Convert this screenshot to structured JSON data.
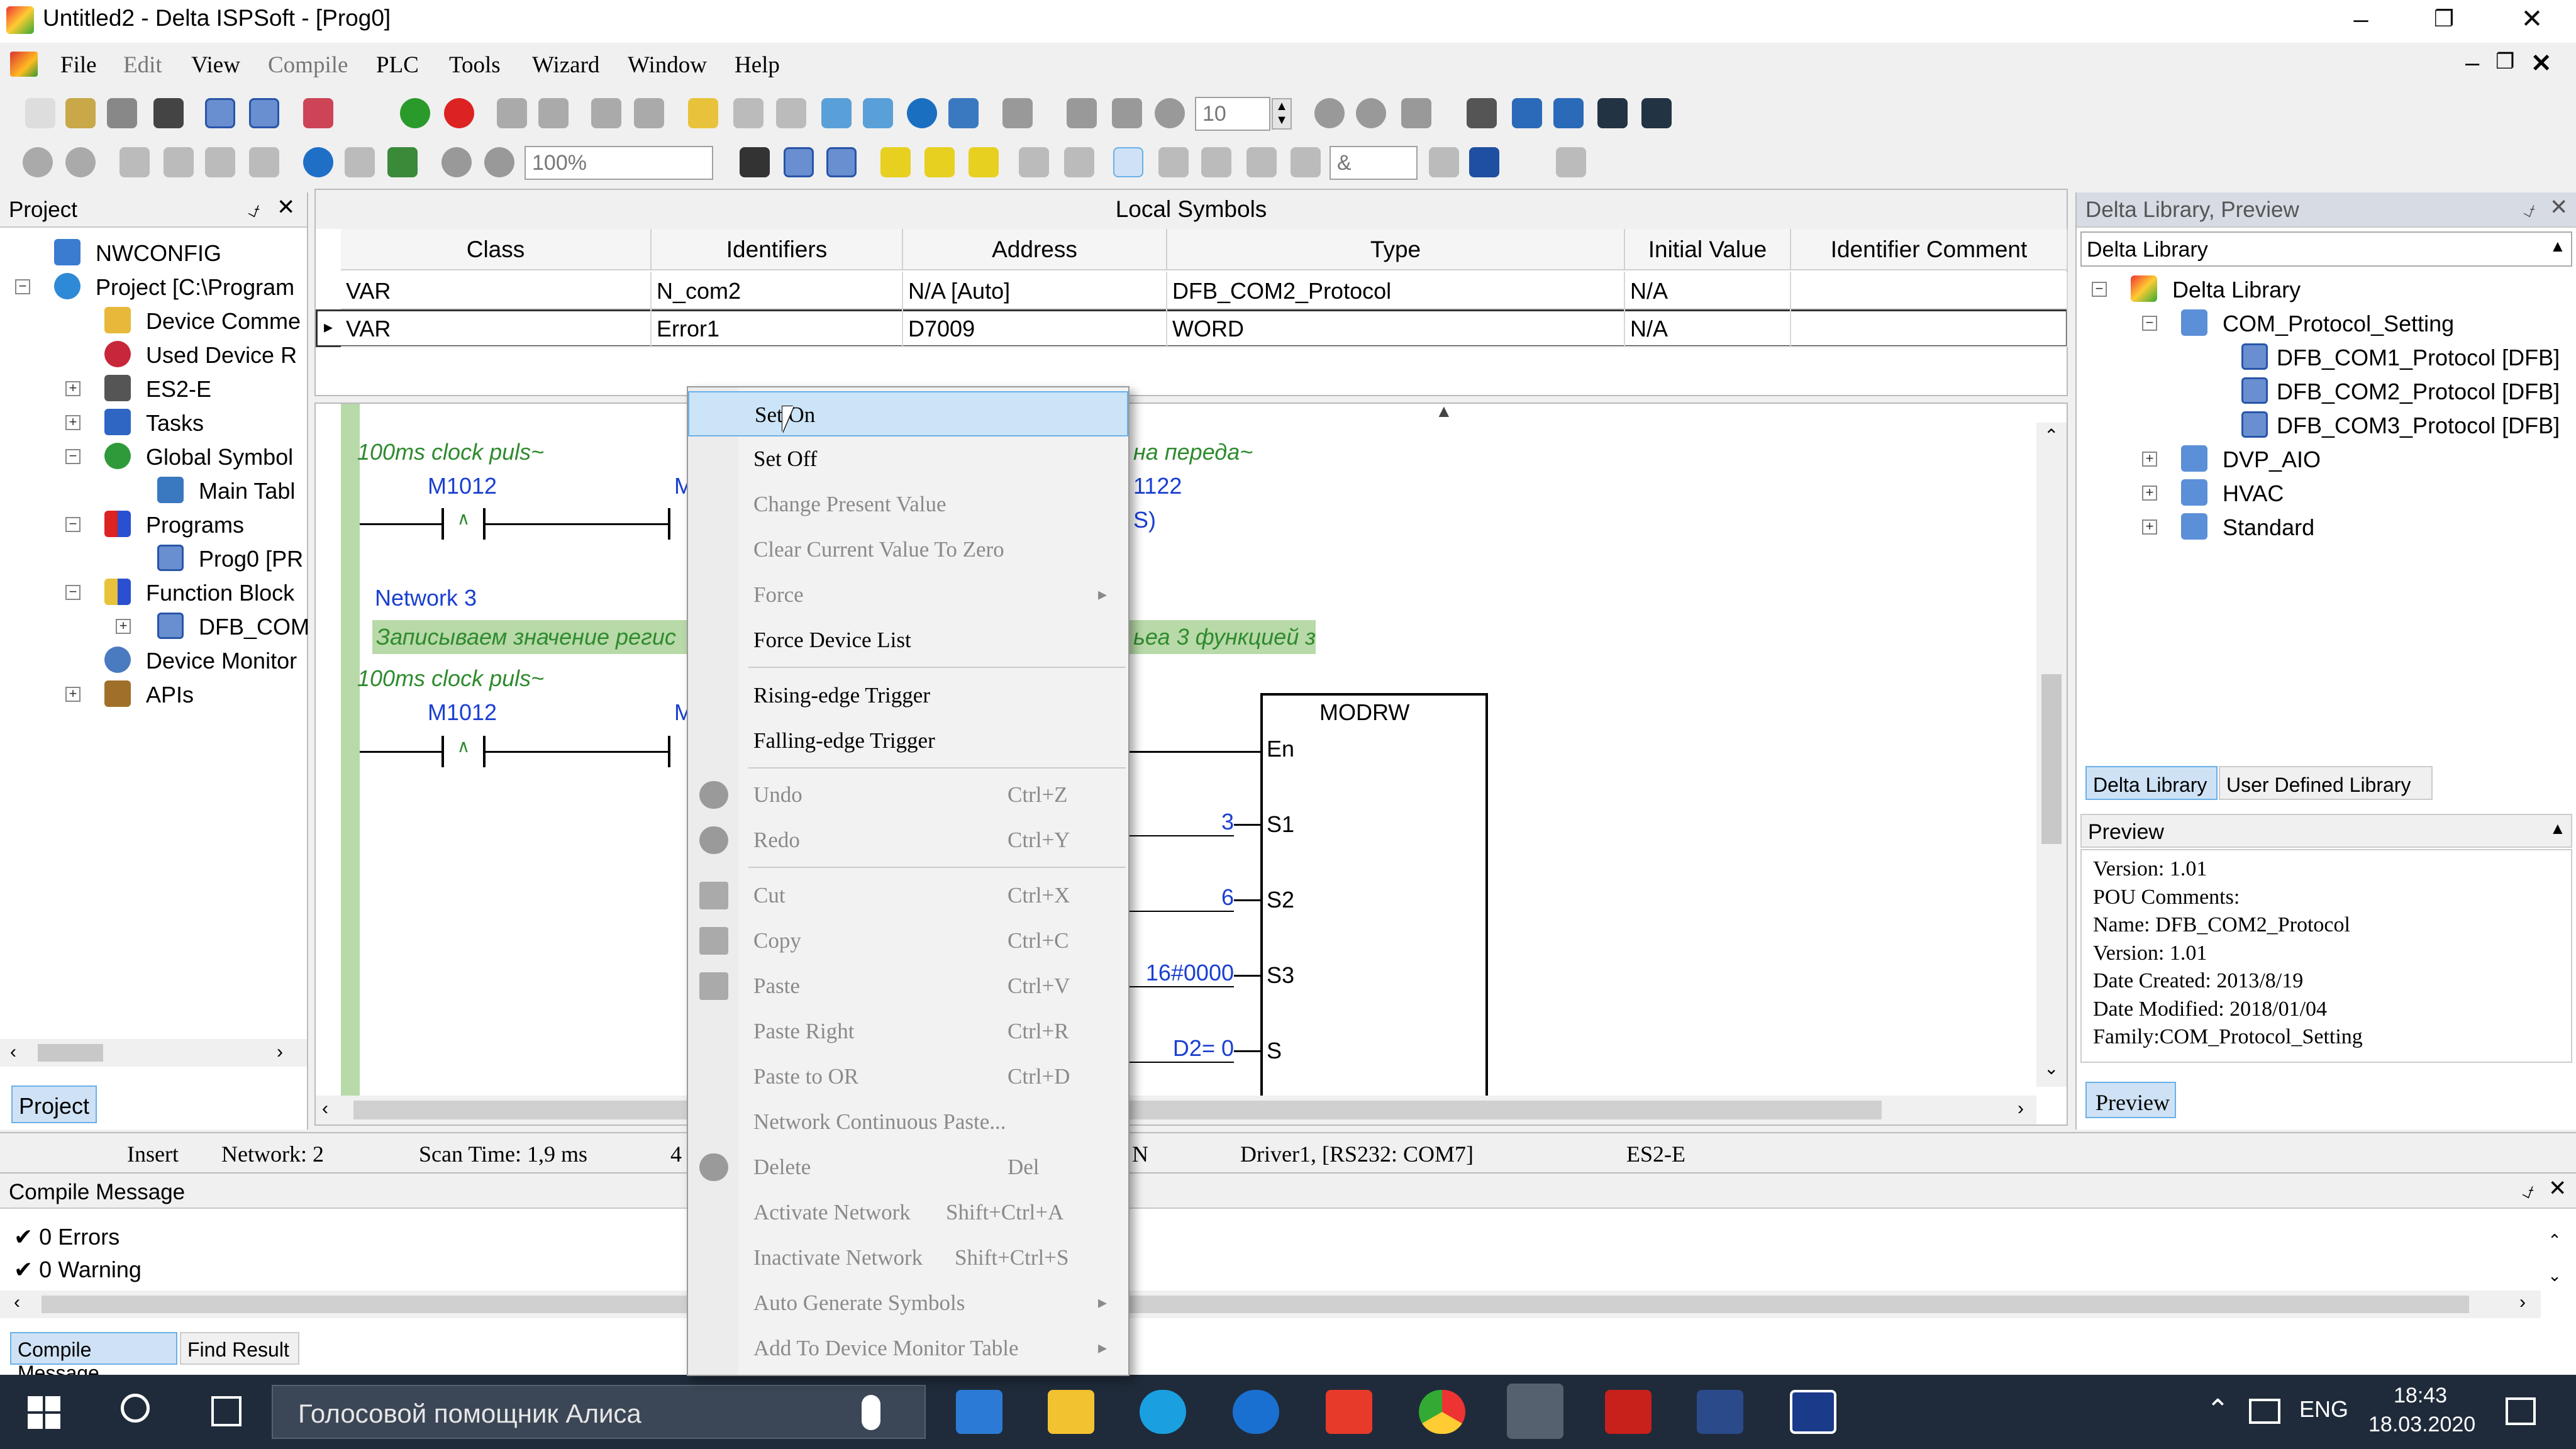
{
  "window": {
    "title": "Untitled2 - Delta ISPSoft - [Prog0]"
  },
  "menu": [
    "File",
    "Edit",
    "View",
    "Compile",
    "PLC",
    "Tools",
    "Wizard",
    "Window",
    "Help"
  ],
  "toolbar": {
    "spin_value": "10",
    "zoom_value": "100%",
    "combo_value": "&"
  },
  "project_panel": {
    "title": "Project",
    "tab": "Project",
    "tree": [
      {
        "label": "NWCONFIG"
      },
      {
        "label": "Project [C:\\Program"
      },
      {
        "label": "Device Comme"
      },
      {
        "label": "Used Device R"
      },
      {
        "label": "ES2-E"
      },
      {
        "label": "Tasks"
      },
      {
        "label": "Global Symbol"
      },
      {
        "label": "Main Tabl"
      },
      {
        "label": "Programs"
      },
      {
        "label": "Prog0 [PR"
      },
      {
        "label": "Function Block"
      },
      {
        "label": "DFB_COM"
      },
      {
        "label": "Device Monitor"
      },
      {
        "label": "APIs"
      }
    ]
  },
  "local_symbols": {
    "title": "Local Symbols",
    "columns": [
      "Class",
      "Identifiers",
      "Address",
      "Type",
      "Initial Value",
      "Identifier Comment"
    ],
    "rows": [
      [
        "VAR",
        "N_com2",
        "N/A [Auto]",
        "DFB_COM2_Protocol",
        "N/A",
        ""
      ],
      [
        "VAR",
        "Error1",
        "D7009",
        "WORD",
        "N/A",
        ""
      ]
    ]
  },
  "ladder": {
    "comment1": "100ms clock puls~",
    "contact1": "M1012",
    "contact1b": "M",
    "right_comment": "на переда~",
    "right_addr": "1122",
    "coil": "S",
    "network3": "Network 3",
    "network3_comment": "Записываем значение регис",
    "network3_comment_right": "ьеа 3 функцией з",
    "comment2": "100ms clock puls~",
    "contact2": "M1012",
    "contact2b": "M",
    "fb_name": "MODRW",
    "fb_pins": [
      "En",
      "S1",
      "S2",
      "S3",
      "S"
    ],
    "fb_inputs": [
      "3",
      "6",
      "16#0000",
      "D2= 0"
    ]
  },
  "library": {
    "title": "Delta Library, Preview",
    "dropdown": "Delta Library",
    "tree": [
      "Delta Library",
      "COM_Protocol_Setting",
      "DFB_COM1_Protocol [DFB]",
      "DFB_COM2_Protocol [DFB]",
      "DFB_COM3_Protocol [DFB]",
      "DVP_AIO",
      "HVAC",
      "Standard"
    ],
    "tabs": [
      "Delta Library",
      "User Defined Library"
    ],
    "preview_title": "Preview",
    "preview_lines": [
      "Version: 1.01",
      "POU Comments:",
      "Name: DFB_COM2_Protocol",
      "Version: 1.01",
      "Date Created:   2013/8/19",
      "Date Modified: 2018/01/04",
      "Family:COM_Protocol_Setting"
    ],
    "preview_tab": "Preview"
  },
  "status": {
    "mode": "Insert",
    "network": "Network: 2",
    "scan": "Scan Time: 1,9 ms",
    "cut": "4",
    "n": "N",
    "driver": "Driver1, [RS232: COM7]",
    "plc": "ES2-E"
  },
  "compile": {
    "title": "Compile Message",
    "lines": [
      "0 Errors",
      "0 Warning"
    ],
    "tabs": [
      "Compile Message",
      "Find Result"
    ]
  },
  "context_menu": [
    {
      "label": "Set On",
      "shortcut": "",
      "disabled": false,
      "highlight": true
    },
    {
      "label": "Set Off",
      "shortcut": "",
      "disabled": false
    },
    {
      "label": "Change Present Value",
      "shortcut": "",
      "disabled": true
    },
    {
      "label": "Clear Current Value To Zero",
      "shortcut": "",
      "disabled": true
    },
    {
      "label": "Force",
      "shortcut": "",
      "disabled": true,
      "submenu": true
    },
    {
      "label": "Force Device List",
      "shortcut": "",
      "disabled": false
    },
    {
      "label": "Rising-edge Trigger",
      "shortcut": "",
      "disabled": false
    },
    {
      "label": "Falling-edge Trigger",
      "shortcut": "",
      "disabled": false
    },
    {
      "label": "Undo",
      "shortcut": "Ctrl+Z",
      "disabled": true
    },
    {
      "label": "Redo",
      "shortcut": "Ctrl+Y",
      "disabled": true
    },
    {
      "label": "Cut",
      "shortcut": "Ctrl+X",
      "disabled": true
    },
    {
      "label": "Copy",
      "shortcut": "Ctrl+C",
      "disabled": true
    },
    {
      "label": "Paste",
      "shortcut": "Ctrl+V",
      "disabled": true
    },
    {
      "label": "Paste Right",
      "shortcut": "Ctrl+R",
      "disabled": true
    },
    {
      "label": "Paste to OR",
      "shortcut": "Ctrl+D",
      "disabled": true
    },
    {
      "label": "Network Continuous Paste...",
      "shortcut": "",
      "disabled": true
    },
    {
      "label": "Delete",
      "shortcut": "Del",
      "disabled": true
    },
    {
      "label": "Activate Network",
      "shortcut": "Shift+Ctrl+A",
      "disabled": true
    },
    {
      "label": "Inactivate Network",
      "shortcut": "Shift+Ctrl+S",
      "disabled": true
    },
    {
      "label": "Auto Generate Symbols",
      "shortcut": "",
      "disabled": true,
      "submenu": true
    },
    {
      "label": "Add To Device Monitor Table",
      "shortcut": "",
      "disabled": true,
      "submenu": true
    }
  ],
  "taskbar": {
    "search": "Голосовой помощник Алиса",
    "lang": "ENG",
    "time": "18:43",
    "date": "18.03.2020"
  }
}
